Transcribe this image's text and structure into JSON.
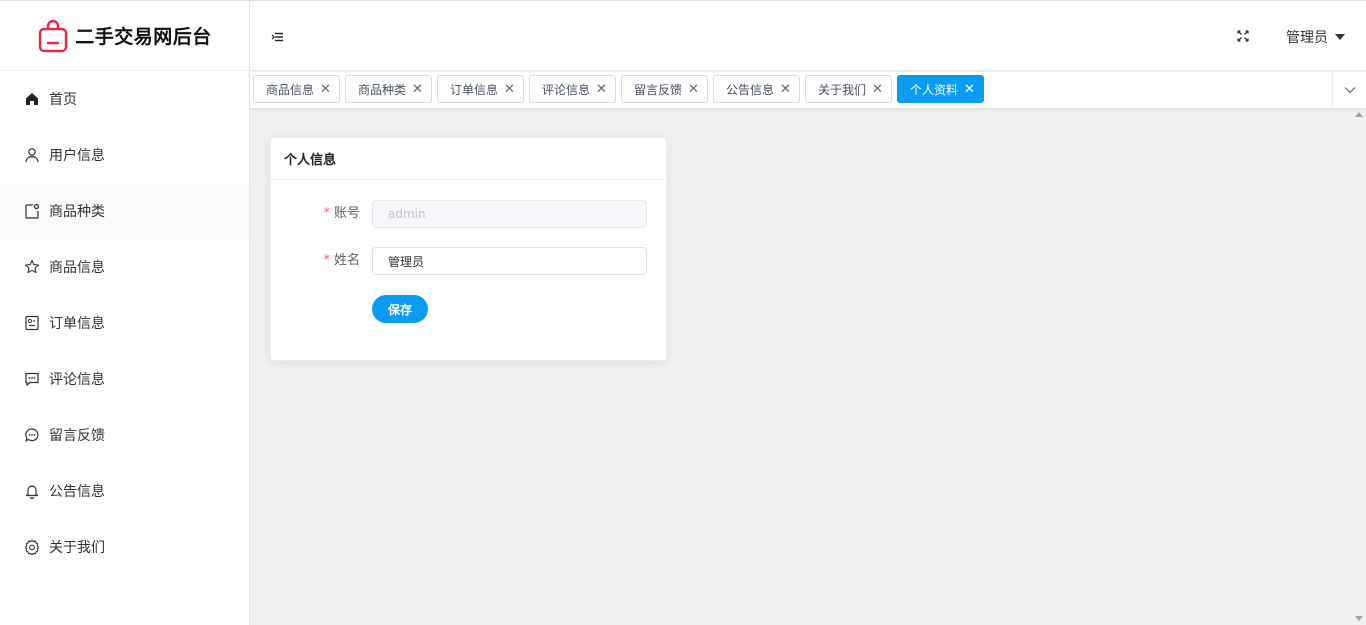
{
  "app": {
    "title": "二手交易网后台",
    "accent": "#0a9cf1",
    "logo_color": "#e8284b"
  },
  "sidebar": {
    "items": [
      {
        "label": "首页",
        "icon": "home-icon"
      },
      {
        "label": "用户信息",
        "icon": "user-icon"
      },
      {
        "label": "商品种类",
        "icon": "category-icon"
      },
      {
        "label": "商品信息",
        "icon": "star-icon"
      },
      {
        "label": "订单信息",
        "icon": "order-icon"
      },
      {
        "label": "评论信息",
        "icon": "comment-icon"
      },
      {
        "label": "留言反馈",
        "icon": "chat-icon"
      },
      {
        "label": "公告信息",
        "icon": "bell-icon"
      },
      {
        "label": "关于我们",
        "icon": "gear-icon"
      }
    ]
  },
  "header": {
    "user_name": "管理员"
  },
  "tags": [
    {
      "label": "商品信息",
      "active": false
    },
    {
      "label": "商品种类",
      "active": false
    },
    {
      "label": "订单信息",
      "active": false
    },
    {
      "label": "评论信息",
      "active": false
    },
    {
      "label": "留言反馈",
      "active": false
    },
    {
      "label": "公告信息",
      "active": false
    },
    {
      "label": "关于我们",
      "active": false
    },
    {
      "label": "个人资料",
      "active": true
    }
  ],
  "profile_card": {
    "title": "个人信息",
    "account_label": "账号",
    "account_value": "admin",
    "name_label": "姓名",
    "name_value": "管理员",
    "save_label": "保存"
  }
}
